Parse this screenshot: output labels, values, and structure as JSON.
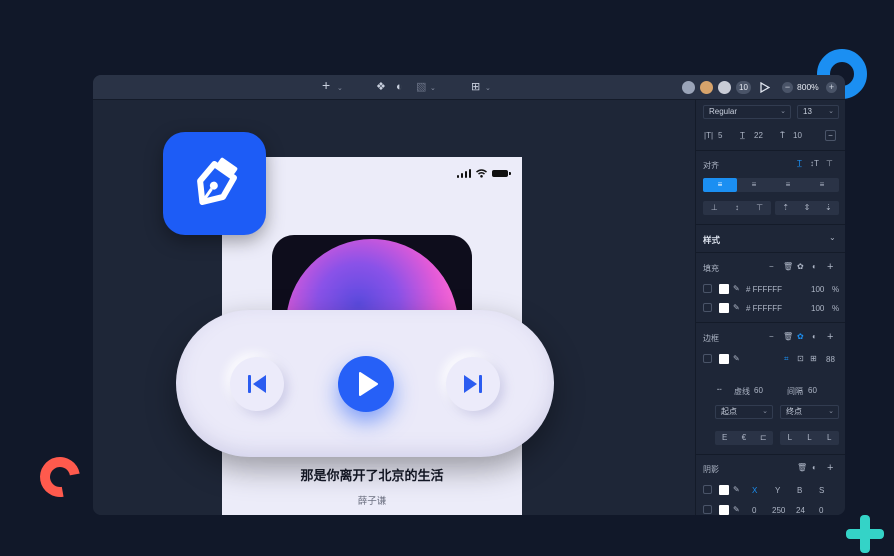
{
  "toolbar": {
    "insert_icon": "+",
    "component_icon": "❖",
    "mask_icon": "◐",
    "boolean_icon": "▧",
    "plugin_icon": "⊞",
    "collaborator_count": "10",
    "zoom_level": "800%",
    "zoom_out": "−",
    "zoom_in": "+"
  },
  "phone": {
    "song_title": "那是你离开了北京的生活",
    "artist": "薛子谦"
  },
  "panel": {
    "font_weight": "Regular",
    "font_size": "13",
    "letter_spacing": "5",
    "line_height": "22",
    "paragraph_spacing": "10",
    "align_label": "对齐",
    "style_label": "样式",
    "fill_label": "填充",
    "fills": [
      {
        "hex": "# FFFFFF",
        "opacity": "100",
        "unit": "%"
      },
      {
        "hex": "# FFFFFF",
        "opacity": "100",
        "unit": "%"
      }
    ],
    "border_label": "边框",
    "border_width": "88",
    "dash_label": "虚线",
    "dash_value": "60",
    "gap_label": "间隔",
    "gap_value": "60",
    "start_label": "起点",
    "end_label": "终点",
    "shadow_label": "阴影",
    "shadow_headers": [
      "X",
      "Y",
      "B",
      "S"
    ],
    "shadow_values": [
      "0",
      "250",
      "24",
      "0"
    ]
  },
  "colors": {
    "accent": "#1b8ff2",
    "brand_blue": "#1d5cf6",
    "background": "#111829",
    "panel": "#1e2637"
  }
}
